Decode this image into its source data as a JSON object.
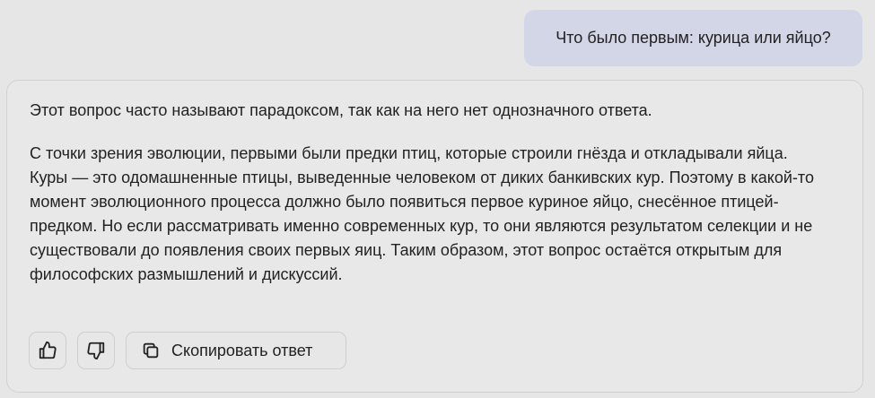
{
  "chat": {
    "user_message": "Что было первым: курица или яйцо?",
    "answer": {
      "paragraphs": [
        "Этот вопрос часто называют парадоксом, так как на него нет однозначного ответа.",
        "С точки зрения эволюции, первыми были предки птиц, которые строили гнёзда и откладывали яйца. Куры — это одомашненные птицы, выведенные человеком от диких банкивских кур. Поэтому в какой-то момент эволюционного процесса должно было появиться первое куриное яйцо, снесённое птицей-предком. Но если рассматривать именно современных кур, то они являются результатом селекции и не существовали до появления своих первых яиц. Таким образом, этот вопрос остаётся открытым для философских размышлений и дискуссий."
      ]
    },
    "actions": {
      "like_icon": "thumbs-up-icon",
      "dislike_icon": "thumbs-down-icon",
      "copy_icon": "copy-icon",
      "copy_label": "Скопировать ответ"
    }
  },
  "colors": {
    "background": "#e6e6e6",
    "user_bubble": "#d2d6e6",
    "card_border": "#d1d1d1"
  }
}
